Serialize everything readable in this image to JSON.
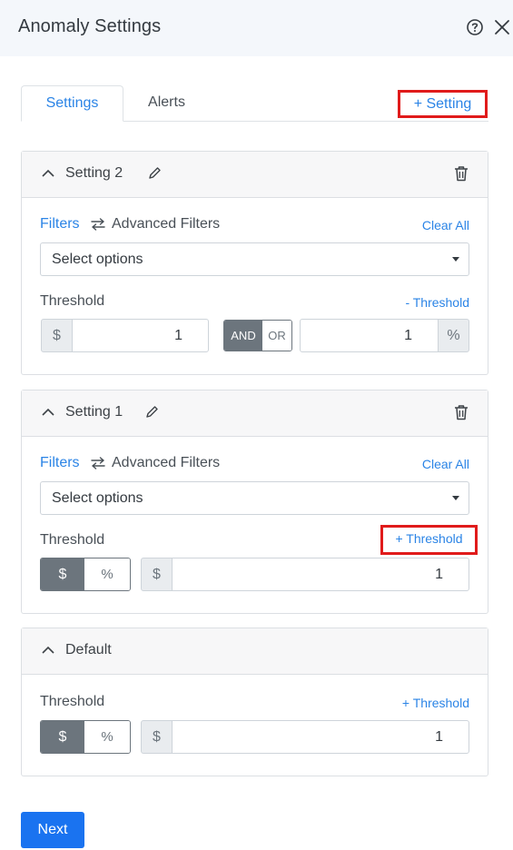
{
  "header": {
    "title": "Anomaly Settings",
    "help_icon": "question-circle-icon",
    "close_icon": "close-icon"
  },
  "tabs": [
    {
      "label": "Settings",
      "active": true
    },
    {
      "label": "Alerts",
      "active": false
    }
  ],
  "add_setting_label": "+ Setting",
  "settings": [
    {
      "title": "Setting 2",
      "filters_label": "Filters",
      "advanced_filters_label": "Advanced Filters",
      "clear_all_label": "Clear All",
      "select_placeholder": "Select options",
      "threshold_label": "Threshold",
      "threshold_link": "- Threshold",
      "currency_symbol": "$",
      "amount_value": "1",
      "and_label": "AND",
      "or_label": "OR",
      "percent_value": "1",
      "percent_symbol": "%"
    },
    {
      "title": "Setting 1",
      "filters_label": "Filters",
      "advanced_filters_label": "Advanced Filters",
      "clear_all_label": "Clear All",
      "select_placeholder": "Select options",
      "threshold_label": "Threshold",
      "threshold_link": "+ Threshold",
      "unit_dollar": "$",
      "unit_percent": "%",
      "currency_symbol": "$",
      "amount_value": "1"
    }
  ],
  "default": {
    "title": "Default",
    "threshold_label": "Threshold",
    "threshold_link": "+ Threshold",
    "unit_dollar": "$",
    "unit_percent": "%",
    "currency_symbol": "$",
    "amount_value": "1"
  },
  "next_label": "Next",
  "colors": {
    "accent": "#2b84e6",
    "primary_button": "#1a73f0",
    "highlight_box": "#e01b1b",
    "toggle_active": "#6c757d"
  }
}
